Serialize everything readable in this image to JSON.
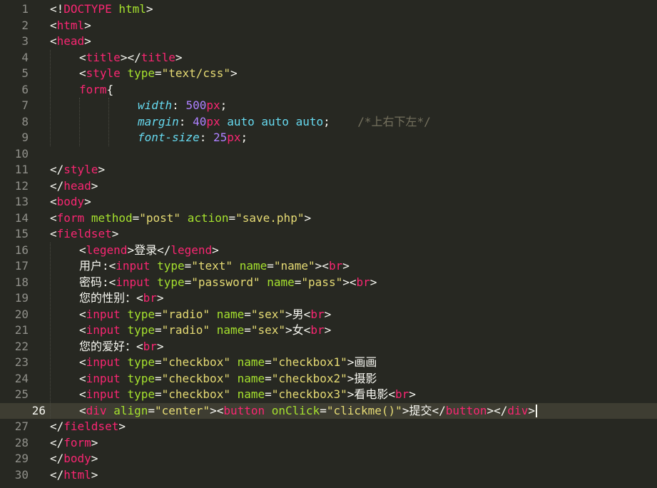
{
  "editor": {
    "active_line": 26,
    "lines": [
      {
        "n": "1",
        "indent": 0,
        "tokens": [
          {
            "c": "plain",
            "t": "<!"
          },
          {
            "c": "doctype",
            "t": "DOCTYPE"
          },
          {
            "c": "plain",
            "t": " "
          },
          {
            "c": "attr",
            "t": "html"
          },
          {
            "c": "plain",
            "t": ">"
          }
        ]
      },
      {
        "n": "2",
        "indent": 0,
        "tokens": [
          {
            "c": "plain",
            "t": "<"
          },
          {
            "c": "tag",
            "t": "html"
          },
          {
            "c": "plain",
            "t": ">"
          }
        ]
      },
      {
        "n": "3",
        "indent": 0,
        "tokens": [
          {
            "c": "plain",
            "t": "<"
          },
          {
            "c": "tag",
            "t": "head"
          },
          {
            "c": "plain",
            "t": ">"
          }
        ]
      },
      {
        "n": "4",
        "indent": 1,
        "tokens": [
          {
            "c": "plain",
            "t": "<"
          },
          {
            "c": "tag",
            "t": "title"
          },
          {
            "c": "plain",
            "t": "></"
          },
          {
            "c": "tag",
            "t": "title"
          },
          {
            "c": "plain",
            "t": ">"
          }
        ]
      },
      {
        "n": "5",
        "indent": 1,
        "tokens": [
          {
            "c": "plain",
            "t": "<"
          },
          {
            "c": "tag",
            "t": "style"
          },
          {
            "c": "plain",
            "t": " "
          },
          {
            "c": "attr",
            "t": "type"
          },
          {
            "c": "plain",
            "t": "="
          },
          {
            "c": "str",
            "t": "\"text/css\""
          },
          {
            "c": "plain",
            "t": ">"
          }
        ]
      },
      {
        "n": "6",
        "indent": 1,
        "tokens": [
          {
            "c": "tag",
            "t": "form"
          },
          {
            "c": "plain",
            "t": "{"
          }
        ]
      },
      {
        "n": "7",
        "indent": 3,
        "tokens": [
          {
            "c": "prop",
            "t": "width"
          },
          {
            "c": "plain",
            "t": ": "
          },
          {
            "c": "num",
            "t": "500"
          },
          {
            "c": "unit",
            "t": "px"
          },
          {
            "c": "plain",
            "t": ";"
          }
        ]
      },
      {
        "n": "8",
        "indent": 3,
        "tokens": [
          {
            "c": "prop",
            "t": "margin"
          },
          {
            "c": "plain",
            "t": ": "
          },
          {
            "c": "num",
            "t": "40"
          },
          {
            "c": "unit",
            "t": "px"
          },
          {
            "c": "plain",
            "t": " "
          },
          {
            "c": "kw",
            "t": "auto"
          },
          {
            "c": "plain",
            "t": " "
          },
          {
            "c": "kw",
            "t": "auto"
          },
          {
            "c": "plain",
            "t": " "
          },
          {
            "c": "kw",
            "t": "auto"
          },
          {
            "c": "plain",
            "t": ";    "
          },
          {
            "c": "cmt",
            "t": "/*上右下左*/"
          }
        ]
      },
      {
        "n": "9",
        "indent": 3,
        "tokens": [
          {
            "c": "prop",
            "t": "font-size"
          },
          {
            "c": "plain",
            "t": ": "
          },
          {
            "c": "num",
            "t": "25"
          },
          {
            "c": "unit",
            "t": "px"
          },
          {
            "c": "plain",
            "t": ";"
          }
        ]
      },
      {
        "n": "10",
        "indent": 0,
        "tokens": []
      },
      {
        "n": "11",
        "indent": 0,
        "tokens": [
          {
            "c": "plain",
            "t": "</"
          },
          {
            "c": "tag",
            "t": "style"
          },
          {
            "c": "plain",
            "t": ">"
          }
        ]
      },
      {
        "n": "12",
        "indent": 0,
        "tokens": [
          {
            "c": "plain",
            "t": "</"
          },
          {
            "c": "tag",
            "t": "head"
          },
          {
            "c": "plain",
            "t": ">"
          }
        ]
      },
      {
        "n": "13",
        "indent": 0,
        "tokens": [
          {
            "c": "plain",
            "t": "<"
          },
          {
            "c": "tag",
            "t": "body"
          },
          {
            "c": "plain",
            "t": ">"
          }
        ]
      },
      {
        "n": "14",
        "indent": 0,
        "tokens": [
          {
            "c": "plain",
            "t": "<"
          },
          {
            "c": "tag",
            "t": "form"
          },
          {
            "c": "plain",
            "t": " "
          },
          {
            "c": "attr",
            "t": "method"
          },
          {
            "c": "plain",
            "t": "="
          },
          {
            "c": "str",
            "t": "\"post\""
          },
          {
            "c": "plain",
            "t": " "
          },
          {
            "c": "attr",
            "t": "action"
          },
          {
            "c": "plain",
            "t": "="
          },
          {
            "c": "str",
            "t": "\"save.php\""
          },
          {
            "c": "plain",
            "t": ">"
          }
        ]
      },
      {
        "n": "15",
        "indent": 0,
        "tokens": [
          {
            "c": "plain",
            "t": "<"
          },
          {
            "c": "tag",
            "t": "fieldset"
          },
          {
            "c": "plain",
            "t": ">"
          }
        ]
      },
      {
        "n": "16",
        "indent": 1,
        "tokens": [
          {
            "c": "plain",
            "t": "<"
          },
          {
            "c": "tag",
            "t": "legend"
          },
          {
            "c": "plain",
            "t": ">登录</"
          },
          {
            "c": "tag",
            "t": "legend"
          },
          {
            "c": "plain",
            "t": ">"
          }
        ]
      },
      {
        "n": "17",
        "indent": 1,
        "tokens": [
          {
            "c": "plain",
            "t": "用户:<"
          },
          {
            "c": "tag",
            "t": "input"
          },
          {
            "c": "plain",
            "t": " "
          },
          {
            "c": "attr",
            "t": "type"
          },
          {
            "c": "plain",
            "t": "="
          },
          {
            "c": "str",
            "t": "\"text\""
          },
          {
            "c": "plain",
            "t": " "
          },
          {
            "c": "attr",
            "t": "name"
          },
          {
            "c": "plain",
            "t": "="
          },
          {
            "c": "str",
            "t": "\"name\""
          },
          {
            "c": "plain",
            "t": "><"
          },
          {
            "c": "tag",
            "t": "br"
          },
          {
            "c": "plain",
            "t": ">"
          }
        ]
      },
      {
        "n": "18",
        "indent": 1,
        "tokens": [
          {
            "c": "plain",
            "t": "密码:<"
          },
          {
            "c": "tag",
            "t": "input"
          },
          {
            "c": "plain",
            "t": " "
          },
          {
            "c": "attr",
            "t": "type"
          },
          {
            "c": "plain",
            "t": "="
          },
          {
            "c": "str",
            "t": "\"password\""
          },
          {
            "c": "plain",
            "t": " "
          },
          {
            "c": "attr",
            "t": "name"
          },
          {
            "c": "plain",
            "t": "="
          },
          {
            "c": "str",
            "t": "\"pass\""
          },
          {
            "c": "plain",
            "t": "><"
          },
          {
            "c": "tag",
            "t": "br"
          },
          {
            "c": "plain",
            "t": ">"
          }
        ]
      },
      {
        "n": "19",
        "indent": 1,
        "tokens": [
          {
            "c": "plain",
            "t": "您的性别：<"
          },
          {
            "c": "tag",
            "t": "br"
          },
          {
            "c": "plain",
            "t": ">"
          }
        ]
      },
      {
        "n": "20",
        "indent": 1,
        "tokens": [
          {
            "c": "plain",
            "t": "<"
          },
          {
            "c": "tag",
            "t": "input"
          },
          {
            "c": "plain",
            "t": " "
          },
          {
            "c": "attr",
            "t": "type"
          },
          {
            "c": "plain",
            "t": "="
          },
          {
            "c": "str",
            "t": "\"radio\""
          },
          {
            "c": "plain",
            "t": " "
          },
          {
            "c": "attr",
            "t": "name"
          },
          {
            "c": "plain",
            "t": "="
          },
          {
            "c": "str",
            "t": "\"sex\""
          },
          {
            "c": "plain",
            "t": ">男<"
          },
          {
            "c": "tag",
            "t": "br"
          },
          {
            "c": "plain",
            "t": ">"
          }
        ]
      },
      {
        "n": "21",
        "indent": 1,
        "tokens": [
          {
            "c": "plain",
            "t": "<"
          },
          {
            "c": "tag",
            "t": "input"
          },
          {
            "c": "plain",
            "t": " "
          },
          {
            "c": "attr",
            "t": "type"
          },
          {
            "c": "plain",
            "t": "="
          },
          {
            "c": "str",
            "t": "\"radio\""
          },
          {
            "c": "plain",
            "t": " "
          },
          {
            "c": "attr",
            "t": "name"
          },
          {
            "c": "plain",
            "t": "="
          },
          {
            "c": "str",
            "t": "\"sex\""
          },
          {
            "c": "plain",
            "t": ">女<"
          },
          {
            "c": "tag",
            "t": "br"
          },
          {
            "c": "plain",
            "t": ">"
          }
        ]
      },
      {
        "n": "22",
        "indent": 1,
        "tokens": [
          {
            "c": "plain",
            "t": "您的爱好：<"
          },
          {
            "c": "tag",
            "t": "br"
          },
          {
            "c": "plain",
            "t": ">"
          }
        ]
      },
      {
        "n": "23",
        "indent": 1,
        "tokens": [
          {
            "c": "plain",
            "t": "<"
          },
          {
            "c": "tag",
            "t": "input"
          },
          {
            "c": "plain",
            "t": " "
          },
          {
            "c": "attr",
            "t": "type"
          },
          {
            "c": "plain",
            "t": "="
          },
          {
            "c": "str",
            "t": "\"checkbox\""
          },
          {
            "c": "plain",
            "t": " "
          },
          {
            "c": "attr",
            "t": "name"
          },
          {
            "c": "plain",
            "t": "="
          },
          {
            "c": "str",
            "t": "\"checkbox1\""
          },
          {
            "c": "plain",
            "t": ">画画"
          }
        ]
      },
      {
        "n": "24",
        "indent": 1,
        "tokens": [
          {
            "c": "plain",
            "t": "<"
          },
          {
            "c": "tag",
            "t": "input"
          },
          {
            "c": "plain",
            "t": " "
          },
          {
            "c": "attr",
            "t": "type"
          },
          {
            "c": "plain",
            "t": "="
          },
          {
            "c": "str",
            "t": "\"checkbox\""
          },
          {
            "c": "plain",
            "t": " "
          },
          {
            "c": "attr",
            "t": "name"
          },
          {
            "c": "plain",
            "t": "="
          },
          {
            "c": "str",
            "t": "\"checkbox2\""
          },
          {
            "c": "plain",
            "t": ">摄影"
          }
        ]
      },
      {
        "n": "25",
        "indent": 1,
        "tokens": [
          {
            "c": "plain",
            "t": "<"
          },
          {
            "c": "tag",
            "t": "input"
          },
          {
            "c": "plain",
            "t": " "
          },
          {
            "c": "attr",
            "t": "type"
          },
          {
            "c": "plain",
            "t": "="
          },
          {
            "c": "str",
            "t": "\"checkbox\""
          },
          {
            "c": "plain",
            "t": " "
          },
          {
            "c": "attr",
            "t": "name"
          },
          {
            "c": "plain",
            "t": "="
          },
          {
            "c": "str",
            "t": "\"checkbox3\""
          },
          {
            "c": "plain",
            "t": ">看电影<"
          },
          {
            "c": "tag",
            "t": "br"
          },
          {
            "c": "plain",
            "t": ">"
          }
        ]
      },
      {
        "n": "26",
        "indent": 1,
        "tokens": [
          {
            "c": "plain",
            "t": "<"
          },
          {
            "c": "tag",
            "t": "div"
          },
          {
            "c": "plain",
            "t": " "
          },
          {
            "c": "attr",
            "t": "align"
          },
          {
            "c": "plain",
            "t": "="
          },
          {
            "c": "str",
            "t": "\"center\""
          },
          {
            "c": "plain",
            "t": "><"
          },
          {
            "c": "tag",
            "t": "button"
          },
          {
            "c": "plain",
            "t": " "
          },
          {
            "c": "attr",
            "t": "onClick"
          },
          {
            "c": "plain",
            "t": "="
          },
          {
            "c": "str",
            "t": "\"clickme()\""
          },
          {
            "c": "plain",
            "t": ">提交</"
          },
          {
            "c": "tag",
            "t": "button"
          },
          {
            "c": "plain",
            "t": "></"
          },
          {
            "c": "tag",
            "t": "div"
          },
          {
            "c": "plain",
            "t": ">"
          }
        ]
      },
      {
        "n": "27",
        "indent": 0,
        "tokens": [
          {
            "c": "plain",
            "t": "</"
          },
          {
            "c": "tag",
            "t": "fieldset"
          },
          {
            "c": "plain",
            "t": ">"
          }
        ]
      },
      {
        "n": "28",
        "indent": 0,
        "tokens": [
          {
            "c": "plain",
            "t": "</"
          },
          {
            "c": "tag",
            "t": "form"
          },
          {
            "c": "plain",
            "t": ">"
          }
        ]
      },
      {
        "n": "29",
        "indent": 0,
        "tokens": [
          {
            "c": "plain",
            "t": "</"
          },
          {
            "c": "tag",
            "t": "body"
          },
          {
            "c": "plain",
            "t": ">"
          }
        ]
      },
      {
        "n": "30",
        "indent": 0,
        "tokens": [
          {
            "c": "plain",
            "t": "</"
          },
          {
            "c": "tag",
            "t": "html"
          },
          {
            "c": "plain",
            "t": ">"
          }
        ]
      }
    ],
    "colors": {
      "background": "#272822",
      "active_line": "#3e3d32",
      "tag": "#f92672",
      "attribute": "#a6e22e",
      "string": "#e6db74",
      "property": "#66d9ef",
      "number": "#ae81ff",
      "comment": "#75715e"
    }
  }
}
